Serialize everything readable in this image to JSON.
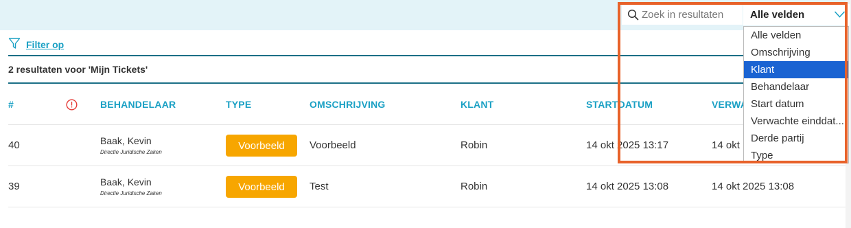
{
  "search": {
    "placeholder": "Zoek in resultaten",
    "field_selected": "Alle velden"
  },
  "field_dropdown": {
    "options": [
      "Alle velden",
      "Omschrijving",
      "Klant",
      "Behandelaar",
      "Start datum",
      "Verwachte einddat...",
      "Derde partij",
      "Type"
    ],
    "highlighted": "Klant"
  },
  "filter": {
    "label": "Filter op"
  },
  "results": {
    "title": "2 resultaten voor 'Mijn Tickets'"
  },
  "table": {
    "headers": {
      "number": "#",
      "priority_icon": "!",
      "behandelaar": "BEHANDELAAR",
      "type": "TYPE",
      "omschrijving": "OMSCHRIJVING",
      "klant": "KLANT",
      "startdatum": "STARTDATUM",
      "verwachte": "VERWA"
    },
    "rows": [
      {
        "number": "40",
        "behandelaar": "Baak, Kevin",
        "afdeling": "Directie Juridische Zaken",
        "type": "Voorbeeld",
        "omschrijving": "Voorbeeld",
        "klant": "Robin",
        "startdatum": "14 okt 2025 13:17",
        "verwachte": "14 okt"
      },
      {
        "number": "39",
        "behandelaar": "Baak, Kevin",
        "afdeling": "Directie Juridische Zaken",
        "type": "Voorbeeld",
        "omschrijving": "Test",
        "klant": "Robin",
        "startdatum": "14 okt 2025 13:08",
        "verwachte": "14 okt 2025 13:08"
      }
    ]
  },
  "colors": {
    "accent": "#1aa0c4",
    "badge": "#f7a600",
    "highlight_frame": "#e8622a",
    "selected_option": "#1a63d2",
    "header_band": "#e3f3f8"
  }
}
